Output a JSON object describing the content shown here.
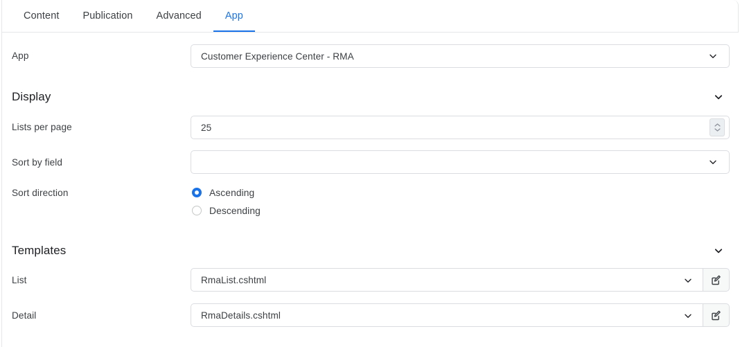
{
  "tabs": [
    {
      "label": "Content",
      "active": false
    },
    {
      "label": "Publication",
      "active": false
    },
    {
      "label": "Advanced",
      "active": false
    },
    {
      "label": "App",
      "active": true
    }
  ],
  "app_row": {
    "label": "App",
    "value": "Customer Experience Center - RMA",
    "chevron_icon": "chevron-down-icon"
  },
  "display_section": {
    "heading": "Display",
    "collapse_icon": "chevron-down-icon",
    "lists_per_page": {
      "label": "Lists per page",
      "value": "25",
      "spinner_icon": "spinner-up-down-icon"
    },
    "sort_by_field": {
      "label": "Sort by field",
      "value": "",
      "chevron_icon": "chevron-down-icon"
    },
    "sort_direction": {
      "label": "Sort direction",
      "options": [
        {
          "label": "Ascending",
          "selected": true
        },
        {
          "label": "Descending",
          "selected": false
        }
      ]
    }
  },
  "templates_section": {
    "heading": "Templates",
    "collapse_icon": "chevron-down-icon",
    "list": {
      "label": "List",
      "value": "RmaList.cshtml",
      "chevron_icon": "chevron-down-icon",
      "edit_icon": "edit-pencil-square-icon"
    },
    "detail": {
      "label": "Detail",
      "value": "RmaDetails.cshtml",
      "chevron_icon": "chevron-down-icon",
      "edit_icon": "edit-pencil-square-icon"
    }
  },
  "colors": {
    "accent": "#1a73e8",
    "text": "#3c4043",
    "heading": "#202124",
    "border": "#dadce0",
    "panel_border": "#e4e6e8",
    "button_bg": "#f7f8f8",
    "spinner_bg": "#eceff1"
  }
}
